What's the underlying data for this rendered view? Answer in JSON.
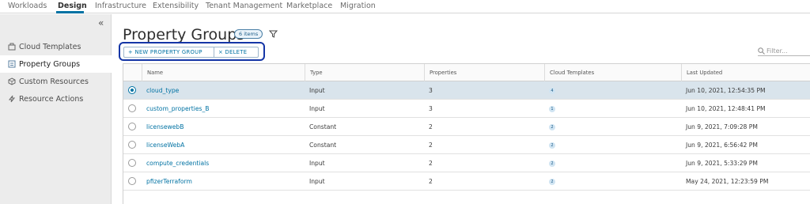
{
  "topnav": {
    "tabs": [
      "Workloads",
      "Design",
      "Infrastructure",
      "Extensibility",
      "Tenant Management",
      "Marketplace",
      "Migration"
    ],
    "active": "Design"
  },
  "sidebar": {
    "collapse_glyph": "«",
    "items": [
      {
        "label": "Cloud Templates",
        "icon": "cloud-templates-icon"
      },
      {
        "label": "Property Groups",
        "icon": "property-groups-icon",
        "active": true
      },
      {
        "label": "Custom Resources",
        "icon": "custom-resources-icon"
      },
      {
        "label": "Resource Actions",
        "icon": "resource-actions-icon"
      }
    ]
  },
  "main": {
    "title": "Property Groups",
    "count_badge": "6 items",
    "new_button": "+  NEW PROPERTY GROUP",
    "delete_button": "×  DELETE",
    "filter_placeholder": "Filter..."
  },
  "table": {
    "columns": [
      "Name",
      "Type",
      "Properties",
      "Cloud Templates",
      "Last Updated"
    ],
    "rows": [
      {
        "name": "cloud_type",
        "type": "Input",
        "properties": "3",
        "cloud_templates": "4",
        "last_updated": "Jun 10, 2021, 12:54:35 PM",
        "selected": true
      },
      {
        "name": "custom_properties_B",
        "type": "Input",
        "properties": "3",
        "cloud_templates": "1",
        "last_updated": "Jun 10, 2021, 12:48:41 PM"
      },
      {
        "name": "licensewebB",
        "type": "Constant",
        "properties": "2",
        "cloud_templates": "2",
        "last_updated": "Jun 9, 2021, 7:09:28 PM"
      },
      {
        "name": "licenseWebA",
        "type": "Constant",
        "properties": "2",
        "cloud_templates": "2",
        "last_updated": "Jun 9, 2021, 6:56:42 PM"
      },
      {
        "name": "compute_credentials",
        "type": "Input",
        "properties": "2",
        "cloud_templates": "2",
        "last_updated": "Jun 9, 2021, 5:33:29 PM"
      },
      {
        "name": "pfizerTerraform",
        "type": "Input",
        "properties": "2",
        "cloud_templates": "2",
        "last_updated": "May 24, 2021, 12:23:59 PM"
      }
    ]
  },
  "colors": {
    "accent": "#0072a3",
    "selected_row": "#d9e4ec",
    "highlight_border": "#1536a6"
  }
}
